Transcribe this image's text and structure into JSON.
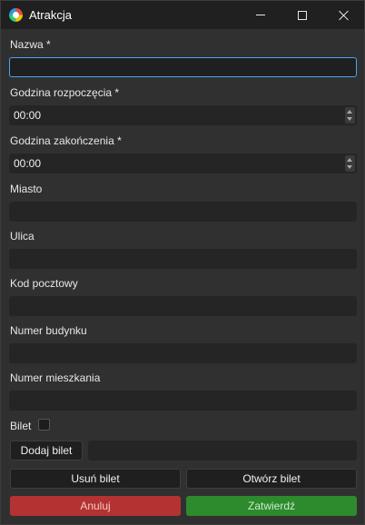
{
  "window": {
    "title": "Atrakcja"
  },
  "form": {
    "nazwa_label": "Nazwa *",
    "nazwa_value": "",
    "start_label": "Godzina rozpoczęcia *",
    "start_value": "00:00",
    "end_label": "Godzina zakończenia *",
    "end_value": "00:00",
    "miasto_label": "Miasto",
    "ulica_label": "Ulica",
    "kod_label": "Kod pocztowy",
    "budynek_label": "Numer budynku",
    "mieszkanie_label": "Numer mieszkania",
    "bilet_label": "Bilet",
    "bilet_checked": false
  },
  "buttons": {
    "add_ticket": "Dodaj bilet",
    "remove_ticket": "Usuń bilet",
    "open_ticket": "Otwórz bilet",
    "cancel": "Anuluj",
    "confirm": "Zatwierdź"
  },
  "colors": {
    "cancel": "#b53232",
    "confirm": "#2d8a2d",
    "focus": "#4aa3f0"
  }
}
